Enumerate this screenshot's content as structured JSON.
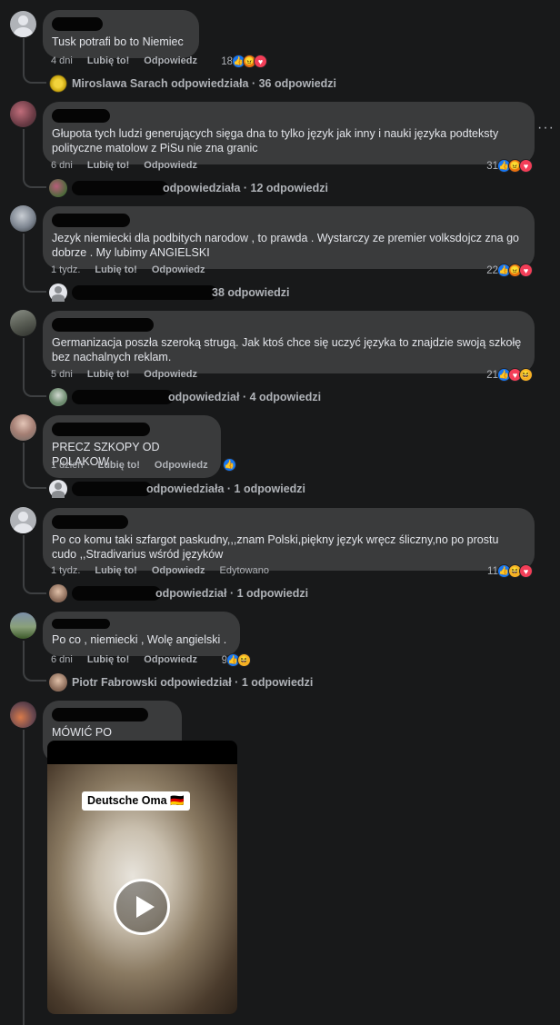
{
  "comments": [
    {
      "text": "Tusk potrafi bo to Niemiec",
      "time": "4 dni",
      "like": "Lubię to!",
      "reply": "Odpowiedz",
      "edited": "",
      "reaction_count": "18",
      "reactions": [
        "like",
        "angry",
        "love"
      ],
      "replies_text": "Miroslawa Sarach odpowiedziała · 36 odpowiedzi"
    },
    {
      "text": "Głupota tych ludzi generujących sięga dna to tylko język jak inny i nauki języka podteksty polityczne matolow z PiSu nie zna granic",
      "time": "6 dni",
      "like": "Lubię to!",
      "reply": "Odpowiedz",
      "edited": "",
      "reaction_count": "31",
      "reactions": [
        "like",
        "angry",
        "love"
      ],
      "replies_text": "odpowiedziała · 12 odpowiedzi"
    },
    {
      "text": "Jezyk niemiecki dla podbitych narodow , to prawda . Wystarczy ze premier volksdojcz zna go dobrze . My lubimy ANGIELSKI",
      "time": "1 tydz.",
      "like": "Lubię to!",
      "reply": "Odpowiedz",
      "edited": "",
      "reaction_count": "22",
      "reactions": [
        "like",
        "angry",
        "love"
      ],
      "replies_text": "38 odpowiedzi"
    },
    {
      "text": "Germanizacja poszła szeroką strugą. Jak ktoś chce się uczyć języka to znajdzie swoją szkołę bez nachalnych reklam.",
      "time": "5 dni",
      "like": "Lubię to!",
      "reply": "Odpowiedz",
      "edited": "",
      "reaction_count": "21",
      "reactions": [
        "like",
        "love",
        "haha"
      ],
      "replies_text": "odpowiedział · 4 odpowiedzi"
    },
    {
      "text": "PRECZ SZKOPY OD POLAKOW",
      "time": "1 dzień",
      "like": "Lubię to!",
      "reply": "Odpowiedz",
      "edited": "",
      "reaction_count": "",
      "reactions": [
        "like"
      ],
      "replies_text": "odpowiedziała · 1 odpowiedzi"
    },
    {
      "text": "Po co komu taki szfargot paskudny,,,znam Polski,piękny język wręcz śliczny,no po prostu cudo ,,Stradivarius wśród języków",
      "time": "1 tydz.",
      "like": "Lubię to!",
      "reply": "Odpowiedz",
      "edited": "Edytowano",
      "reaction_count": "11",
      "reactions": [
        "like",
        "haha",
        "love"
      ],
      "replies_text": "odpowiedział · 1 odpowiedzi"
    },
    {
      "text": "Po co , niemiecki , Wolę angielski .",
      "time": "6 dni",
      "like": "Lubię to!",
      "reply": "Odpowiedz",
      "edited": "",
      "reaction_count": "9",
      "reactions": [
        "like",
        "haha"
      ],
      "replies_text": "Piotr Fabrowski odpowiedział · 1 odpowiedzi"
    },
    {
      "text": "MÓWIĆ PO POLSKU!!!!",
      "video_label": "Deutsche Oma 🇩🇪"
    }
  ],
  "more_options": "···",
  "colors": {
    "background": "#18191a",
    "bubble": "#3a3b3c",
    "like": "#1877f2",
    "angry": "#e9710f",
    "love": "#f33e58",
    "haha": "#f7b125"
  }
}
